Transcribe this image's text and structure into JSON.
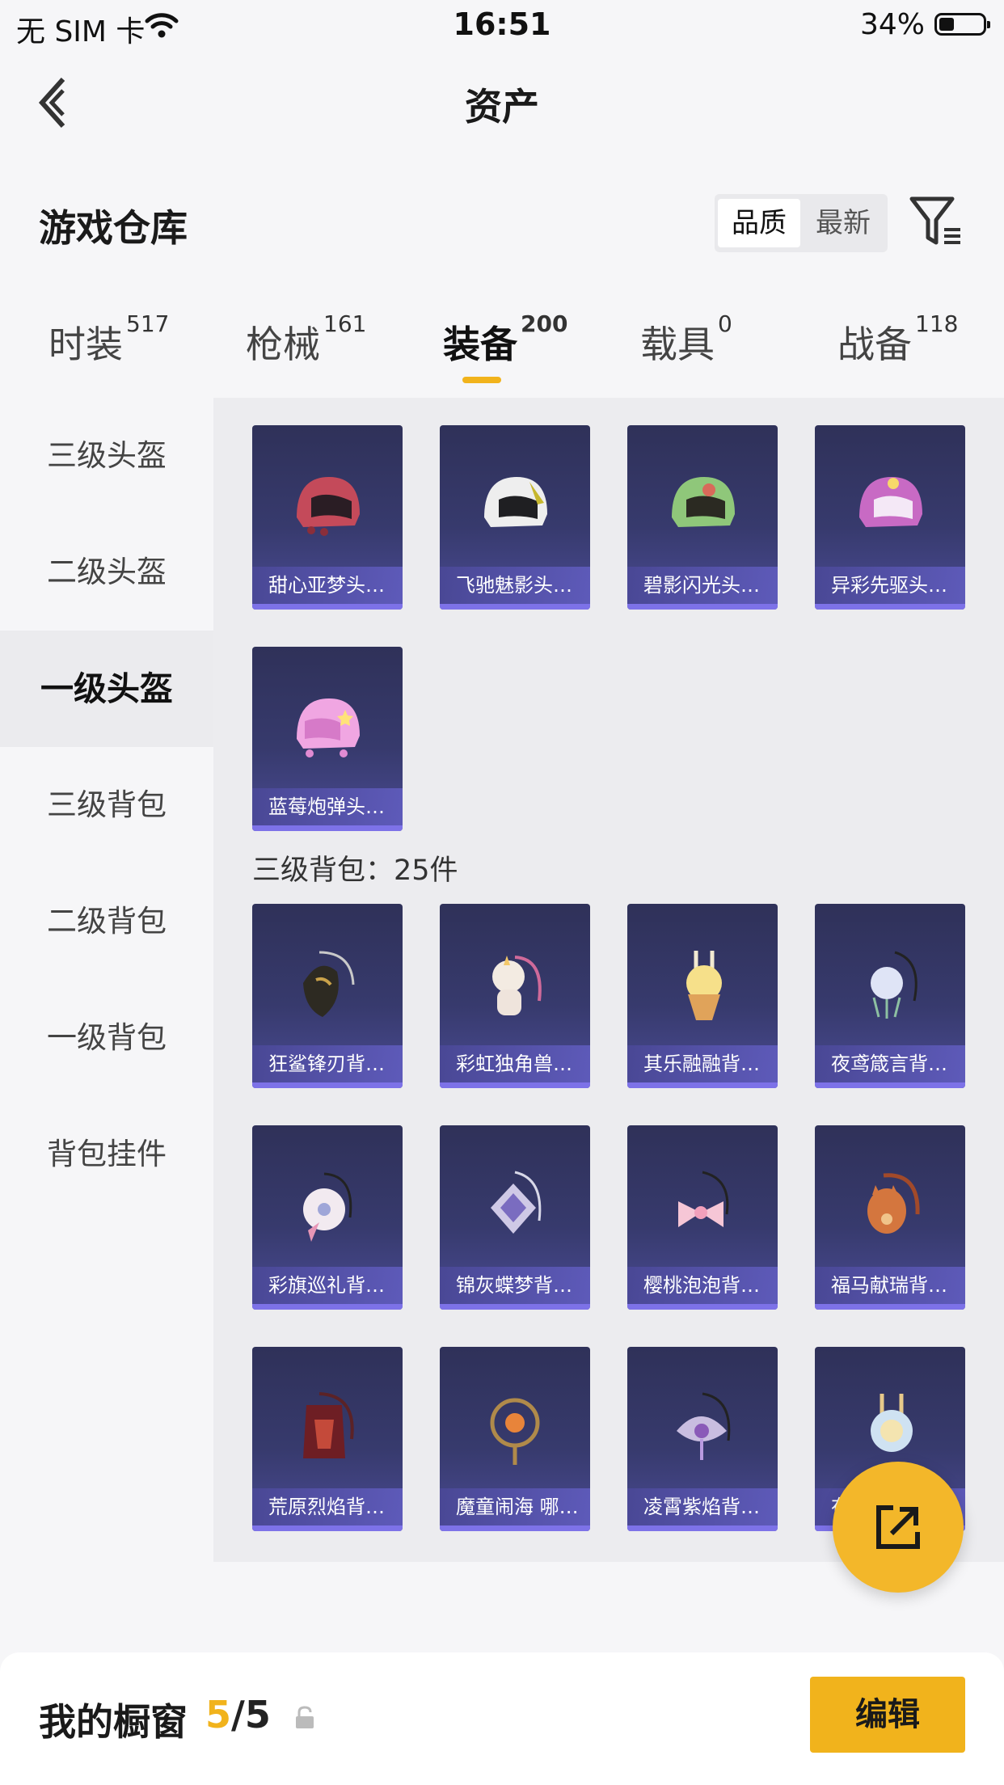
{
  "status_bar": {
    "carrier": "无 SIM 卡",
    "time": "16:51",
    "battery": "34%",
    "battery_level": 0.34
  },
  "header": {
    "title": "资产"
  },
  "section": {
    "title": "游戏仓库",
    "sort": [
      "品质",
      "最新"
    ]
  },
  "tabs": [
    {
      "label": "时装",
      "count": "517"
    },
    {
      "label": "枪械",
      "count": "161"
    },
    {
      "label": "装备",
      "count": "200"
    },
    {
      "label": "载具",
      "count": "0"
    },
    {
      "label": "战备",
      "count": "118"
    }
  ],
  "sidebar": [
    {
      "label": "三级头盔"
    },
    {
      "label": "二级头盔"
    },
    {
      "label": "一级头盔"
    },
    {
      "label": "三级背包"
    },
    {
      "label": "二级背包"
    },
    {
      "label": "一级背包"
    },
    {
      "label": "背包挂件"
    }
  ],
  "helmets": [
    {
      "name": "甜心亚梦头…"
    },
    {
      "name": "飞驰魅影头…"
    },
    {
      "name": "碧影闪光头…"
    },
    {
      "name": "异彩先驱头…"
    },
    {
      "name": "蓝莓炮弹头…"
    }
  ],
  "backpack_group": {
    "title": "三级背包：25件"
  },
  "backpacks": [
    {
      "name": "狂鲨锋刃背…"
    },
    {
      "name": "彩虹独角兽…"
    },
    {
      "name": "其乐融融背…"
    },
    {
      "name": "夜鸢箴言背…"
    },
    {
      "name": "彩旗巡礼背…"
    },
    {
      "name": "锦灰蝶梦背…"
    },
    {
      "name": "樱桃泡泡背…"
    },
    {
      "name": "福马献瑞背…"
    },
    {
      "name": "荒原烈焰背…"
    },
    {
      "name": "魔童闹海 哪…"
    },
    {
      "name": "凌霄紫焰背…"
    },
    {
      "name": "在…"
    }
  ],
  "bottom_bar": {
    "title": "我的橱窗",
    "count_current": "5",
    "count_total": "/5",
    "edit_label": "编辑"
  },
  "colors": {
    "accent": "#f1b31c",
    "card": "#373a6d",
    "card_label": "#5a56b4"
  },
  "icons": [
    "wifi-icon",
    "back-arrow-icon",
    "filter-icon",
    "share-icon",
    "lock-icon"
  ]
}
